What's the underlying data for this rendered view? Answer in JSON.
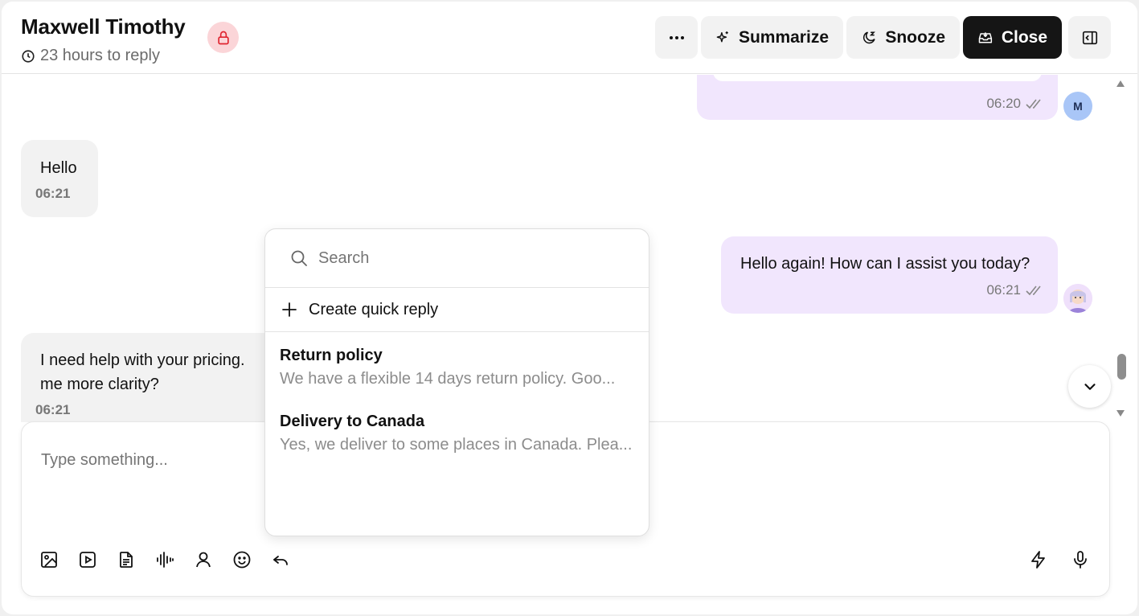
{
  "header": {
    "contact_name": "Maxwell Timothy",
    "reply_time": "23 hours to reply",
    "buttons": {
      "summarize": "Summarize",
      "snooze": "Snooze",
      "close": "Close"
    },
    "icons": [
      "lock-icon",
      "clock-icon",
      "more-icon",
      "sparkle-icon",
      "moon-icon",
      "inbox-icon",
      "panel-icon"
    ],
    "colors": {
      "close_bg": "#151515",
      "lock_bg": "#fbd5d8",
      "lock_icon": "#e0242f"
    }
  },
  "messages": [
    {
      "direction": "outgoing",
      "text": "",
      "time": "06:20",
      "avatar": "M"
    },
    {
      "direction": "incoming",
      "text": "Hello",
      "time": "06:21"
    },
    {
      "direction": "outgoing",
      "text": "Hello again! How can I assist you today?",
      "time": "06:21",
      "avatar": "agent-avatar"
    },
    {
      "direction": "incoming",
      "line1": "I need help with your pricing.",
      "line2": "me more clarity?",
      "time": "06:21"
    }
  ],
  "colors": {
    "outgoing_bubble": "#f1e6fd",
    "incoming_bubble": "#f2f2f2"
  },
  "quick_reply": {
    "search_placeholder": "Search",
    "create_label": "Create quick reply",
    "items": [
      {
        "title": "Return policy",
        "body": "We have a flexible 14 days return policy. Goo..."
      },
      {
        "title": "Delivery to Canada",
        "body": "Yes, we deliver to some places in Canada. Plea..."
      }
    ]
  },
  "composer": {
    "placeholder": "Type something...",
    "tools": [
      "image-icon",
      "video-icon",
      "document-icon",
      "audio-icon",
      "contact-icon",
      "emoji-icon",
      "reply-icon"
    ],
    "right_tools": [
      "quick-reply-icon",
      "microphone-icon"
    ]
  }
}
